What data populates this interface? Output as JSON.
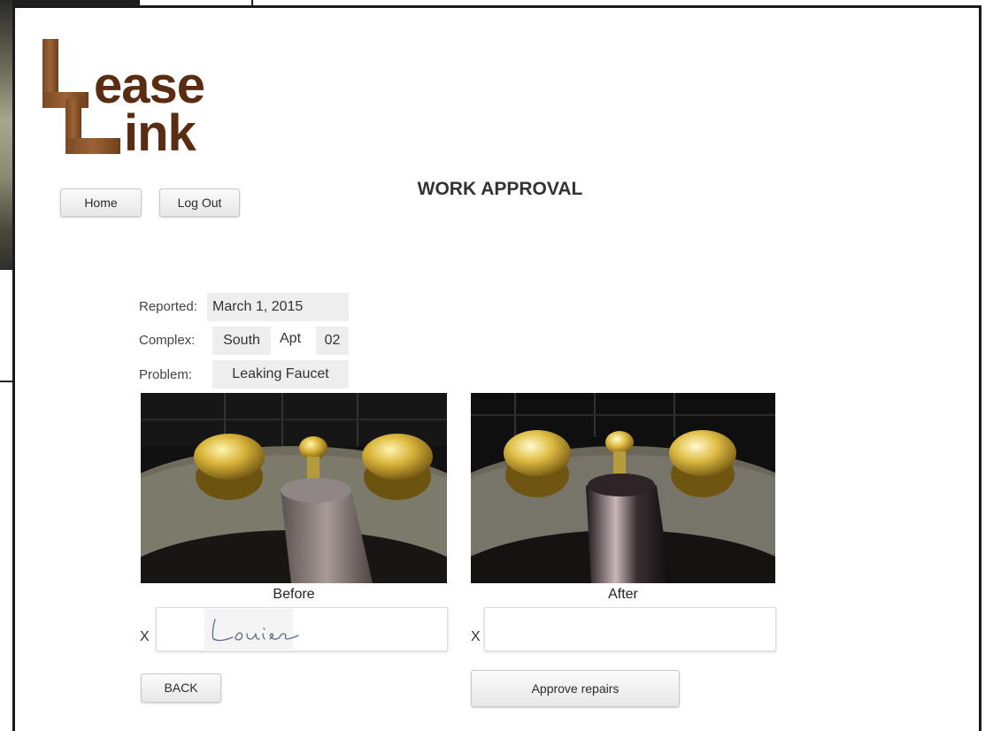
{
  "app": {
    "logo_text_line1": "ease",
    "logo_text_line2": "ink",
    "page_title": "WORK APPROVAL"
  },
  "nav": {
    "home_label": "Home",
    "logout_label": "Log Out"
  },
  "request": {
    "reported_label": "Reported:",
    "reported_value": "March 1, 2015",
    "complex_label": "Complex:",
    "complex_value": "South",
    "apt_label": "Apt",
    "apt_value": "02",
    "problem_label": "Problem:",
    "problem_value": "Leaking Faucet"
  },
  "photos": {
    "before_caption": "Before",
    "after_caption": "After"
  },
  "signatures": {
    "before_mark": "X",
    "before_signature": "Louise",
    "after_mark": "X",
    "after_signature": ""
  },
  "actions": {
    "back_label": "BACK",
    "approve_label": "Approve repairs"
  },
  "colors": {
    "logo_brown": "#5a2d12",
    "button_bg": "#efefef",
    "field_bg": "#eeeeee"
  }
}
